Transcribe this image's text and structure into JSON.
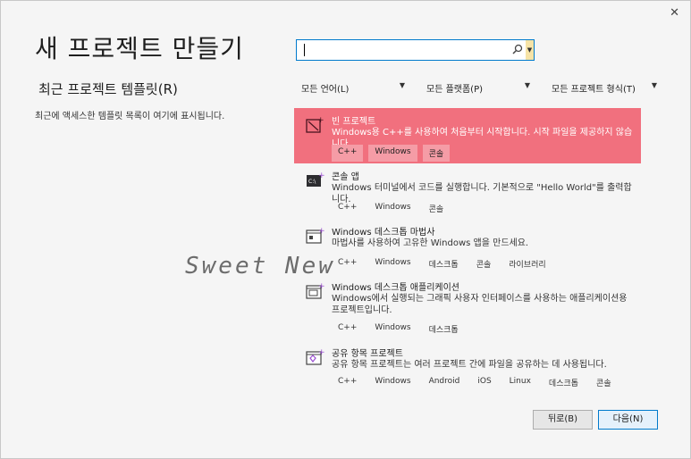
{
  "window": {
    "close_glyph": "✕"
  },
  "header": {
    "title": "새 프로젝트 만들기"
  },
  "recent": {
    "heading": "최근 프로젝트 템플릿(R)",
    "empty_message": "최근에 액세스한 템플릿 목록이 여기에 표시됩니다."
  },
  "search": {
    "value": "",
    "placeholder": ""
  },
  "filters": {
    "language": "모든 언어(L)",
    "platform": "모든 플랫폼(P)",
    "project_type": "모든 프로젝트 형식(T)"
  },
  "templates": [
    {
      "name": "빈 프로젝트",
      "desc": "Windows용 C++를 사용하여 처음부터 시작합니다. 시작 파일을 제공하지 않습니다.",
      "tags": [
        "C++",
        "Windows",
        "콘솔"
      ],
      "selected": true,
      "icon": "empty-project-icon"
    },
    {
      "name": "콘솔 앱",
      "desc": "Windows 터미널에서 코드를 실행합니다. 기본적으로 \"Hello World\"를 출력합니다.",
      "tags": [
        "C++",
        "Windows",
        "콘솔"
      ],
      "selected": false,
      "icon": "console-app-icon"
    },
    {
      "name": "Windows 데스크톱 마법사",
      "desc": "마법사를 사용하여 고유한 Windows 앱을 만드세요.",
      "tags": [
        "C++",
        "Windows",
        "데스크톱",
        "콘솔",
        "라이브러리"
      ],
      "selected": false,
      "icon": "desktop-wizard-icon"
    },
    {
      "name": "Windows 데스크톱 애플리케이션",
      "desc": "Windows에서 실행되는 그래픽 사용자 인터페이스를 사용하는 애플리케이션용 프로젝트입니다.",
      "tags": [
        "C++",
        "Windows",
        "데스크톱"
      ],
      "selected": false,
      "icon": "desktop-app-icon"
    },
    {
      "name": "공유 항목 프로젝트",
      "desc": "공유 항목 프로젝트는 여러 프로젝트 간에 파일을 공유하는 데 사용됩니다.",
      "tags": [
        "C++",
        "Windows",
        "Android",
        "iOS",
        "Linux",
        "데스크톱",
        "콘솔"
      ],
      "selected": false,
      "icon": "shared-items-icon"
    }
  ],
  "watermark": "Sweet New",
  "buttons": {
    "back": "뒤로(B)",
    "next": "다음(N)"
  },
  "colors": {
    "selected_bg": "#f1707e",
    "accent": "#007acc",
    "icon_purple": "#9b4fd1"
  }
}
